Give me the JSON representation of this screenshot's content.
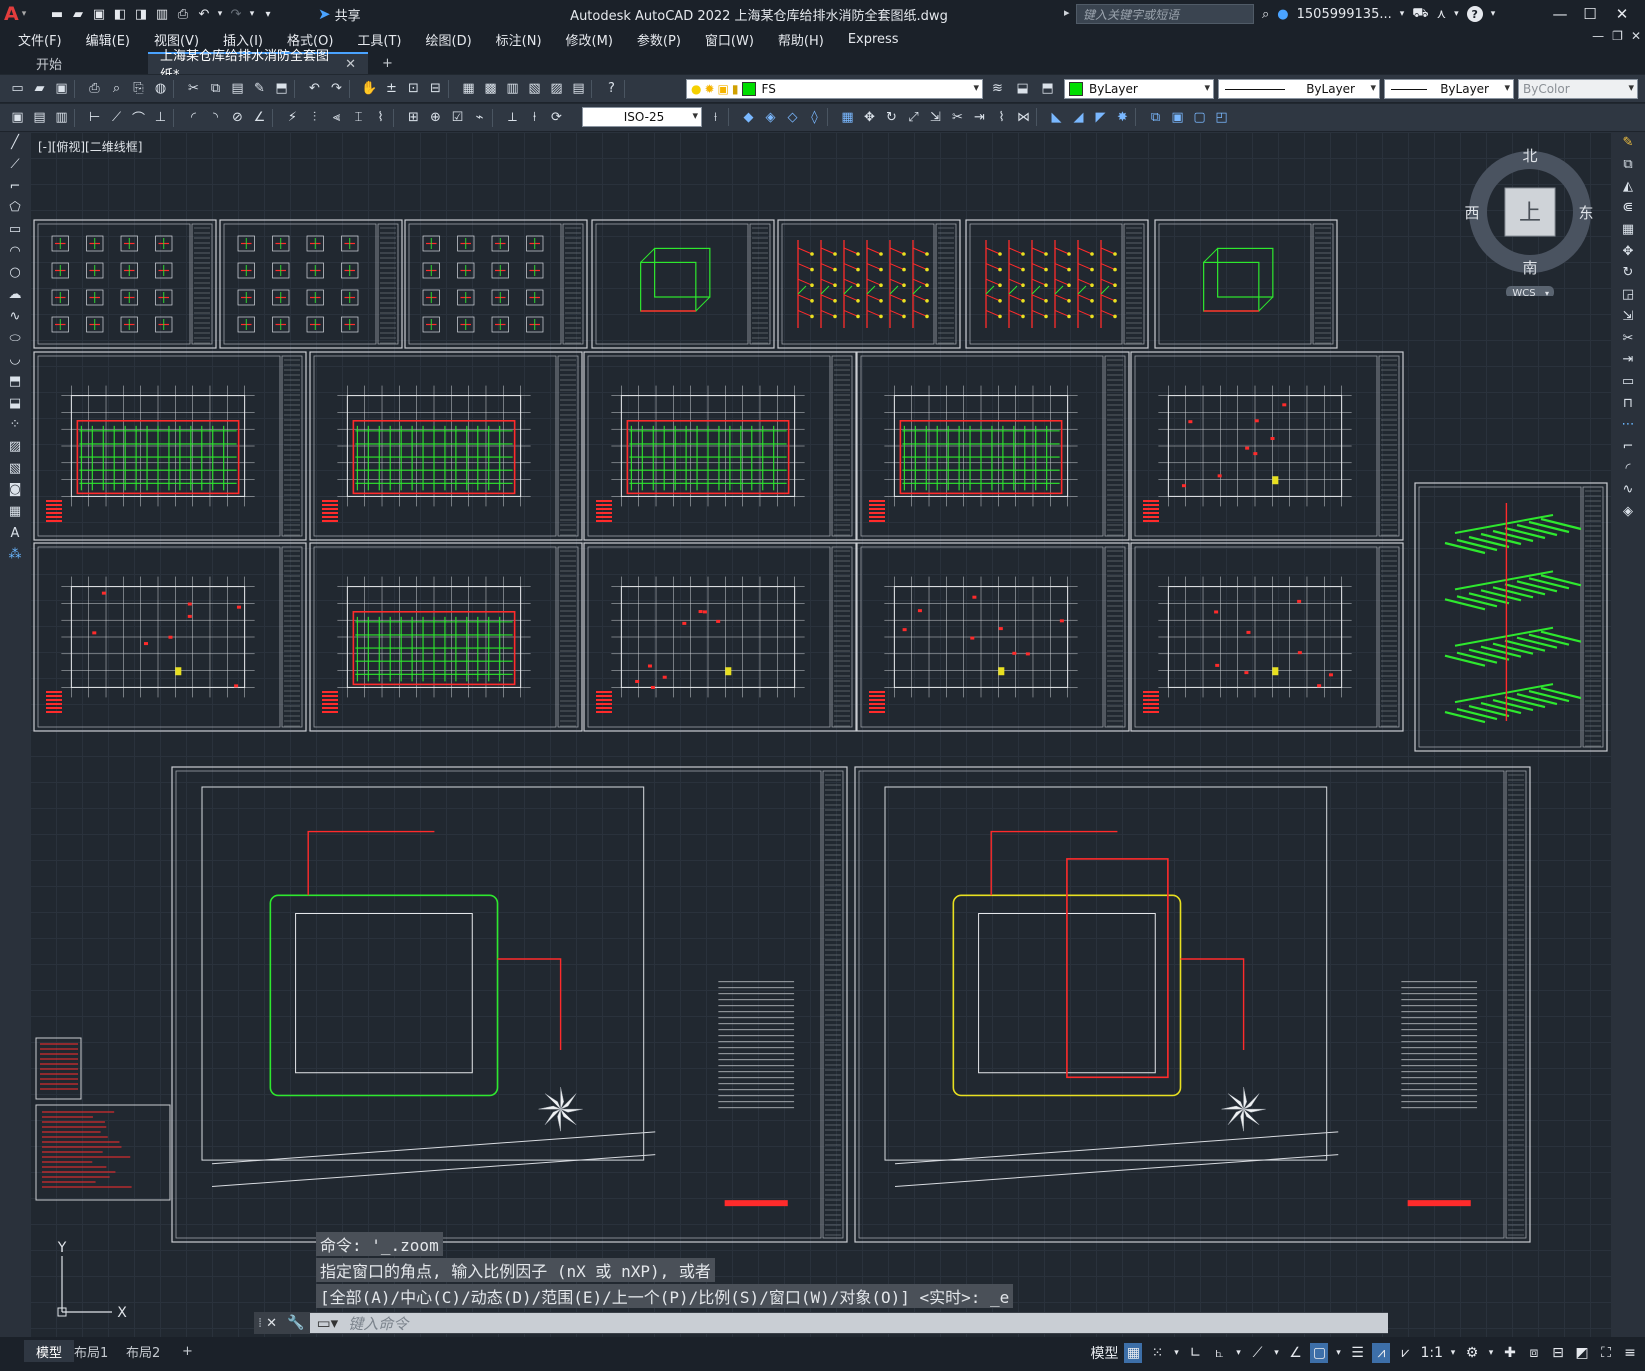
{
  "titlebar": {
    "title": "Autodesk AutoCAD 2022    上海某仓库给排水消防全套图纸.dwg",
    "share_label": "共享",
    "search_placeholder": "键入关键字或短语",
    "user": "1505999135...",
    "help_label": "?"
  },
  "menu": [
    "文件(F)",
    "编辑(E)",
    "视图(V)",
    "插入(I)",
    "格式(O)",
    "工具(T)",
    "绘图(D)",
    "标注(N)",
    "修改(M)",
    "参数(P)",
    "窗口(W)",
    "帮助(H)",
    "Express"
  ],
  "tabs": {
    "start": "开始",
    "file": "上海某仓库给排水消防全套图纸*",
    "add": "+"
  },
  "layer": {
    "name": "FS",
    "color": "#00dd00"
  },
  "properties": {
    "color": "ByLayer",
    "linetype": "ByLayer",
    "lineweight": "ByLayer",
    "plotstyle": "ByColor"
  },
  "dimstyle": "ISO-25",
  "viewport": {
    "label": "[-][俯视][二维线框]"
  },
  "viewcube": {
    "north": "北",
    "south": "南",
    "east": "东",
    "west": "西",
    "face": "上",
    "wcs": "WCS"
  },
  "command": {
    "history": [
      "命令: '_.zoom",
      "指定窗口的角点, 输入比例因子 (nX 或 nXP), 或者",
      "[全部(A)/中心(C)/动态(D)/范围(E)/上一个(P)/比例(S)/窗口(W)/对象(O)] <实时>: _e"
    ],
    "placeholder": "键入命令"
  },
  "layouts": [
    "模型",
    "布局1",
    "布局2",
    "+"
  ],
  "status": {
    "model": "模型",
    "scale": "1:1"
  },
  "colors": {
    "accent": "#4aa3ff",
    "drawing_green": "#2ee82e",
    "drawing_red": "#ff2b2b",
    "drawing_yellow": "#e8e020"
  }
}
